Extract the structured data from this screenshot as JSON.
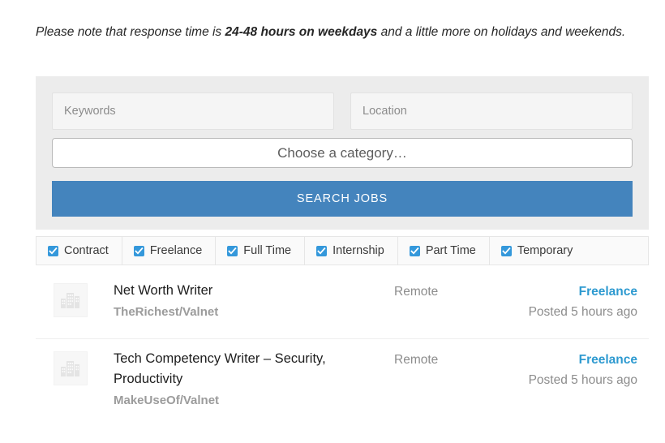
{
  "colors": {
    "panel_bg": "#ececec",
    "button_blue": "#4484bd",
    "link_blue": "#2e9ad0",
    "checkbox_blue": "#3498db",
    "muted_text": "#8d8d8d",
    "company_text": "#9b9b9b"
  },
  "intro": {
    "prefix": "Please note that response time is ",
    "emphasis": "24-48 hours on weekdays",
    "suffix": " and a little more on holidays and weekends."
  },
  "search_form": {
    "keywords": {
      "value": "",
      "placeholder": "Keywords"
    },
    "location": {
      "value": "",
      "placeholder": "Location"
    },
    "category": {
      "selected": "Choose a category…"
    },
    "submit_label": "Search Jobs"
  },
  "filters": [
    {
      "label": "Contract",
      "checked": true
    },
    {
      "label": "Freelance",
      "checked": true
    },
    {
      "label": "Full Time",
      "checked": true
    },
    {
      "label": "Internship",
      "checked": true
    },
    {
      "label": "Part Time",
      "checked": true
    },
    {
      "label": "Temporary",
      "checked": true
    }
  ],
  "listings": [
    {
      "title": "Net Worth Writer",
      "company": "TheRichest/Valnet",
      "location": "Remote",
      "type": "Freelance",
      "posted": "Posted 5 hours ago",
      "logo_icon": "buildings-icon"
    },
    {
      "title": "Tech Competency Writer – Security, Productivity",
      "company": "MakeUseOf/Valnet",
      "location": "Remote",
      "type": "Freelance",
      "posted": "Posted 5 hours ago",
      "logo_icon": "buildings-icon"
    }
  ]
}
